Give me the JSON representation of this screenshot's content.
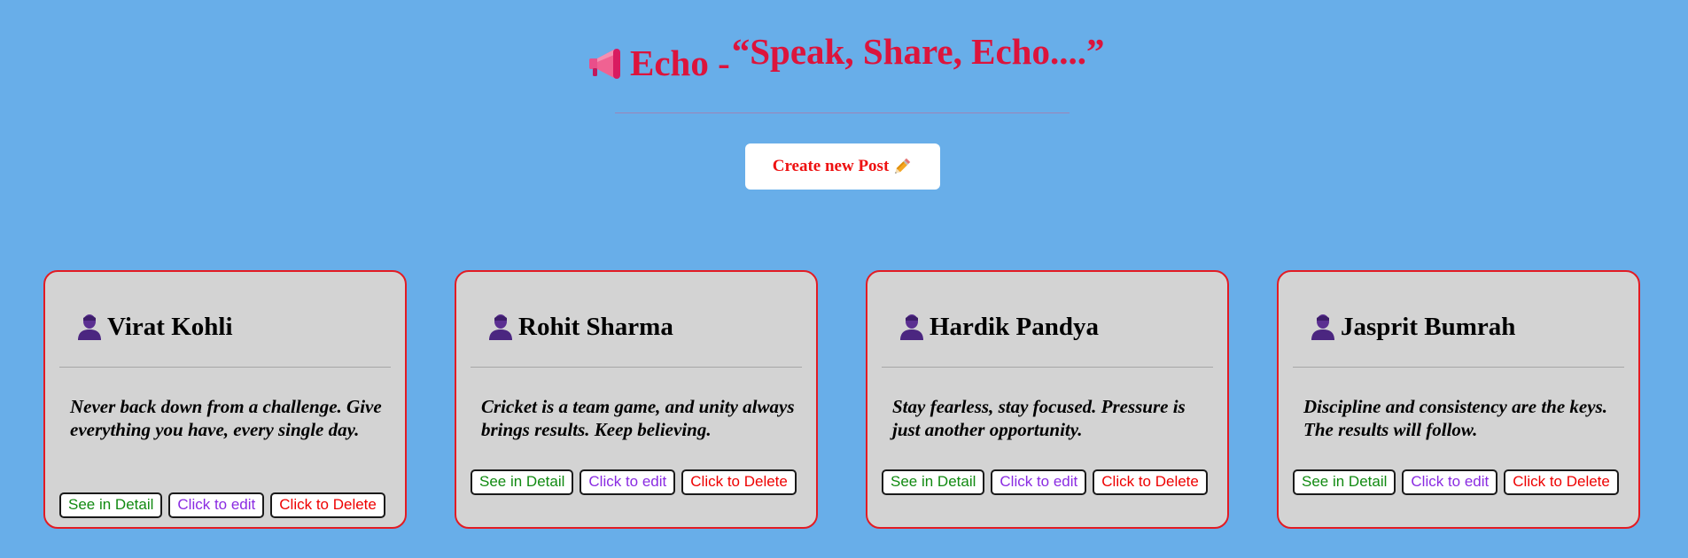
{
  "header": {
    "title": "Echo -",
    "tagline": "“Speak, Share, Echo....”",
    "megaphone_icon": "megaphone-icon",
    "create_button": "Create new Post",
    "pencil_icon": "pencil-icon"
  },
  "colors": {
    "background": "#68aee9",
    "title": "#dc143c",
    "card_background": "#d3d3d3",
    "card_border": "#e31b23",
    "detail": "#118a11",
    "edit": "#8a2be2",
    "delete": "#ee0000"
  },
  "posts": [
    {
      "author": "Virat Kohli",
      "icon": "user-icon",
      "content": "Never back down from a challenge. Give everything you have, every single day.",
      "detail_label": "See in Detail",
      "edit_label": "Click to edit",
      "delete_label": "Click to Delete"
    },
    {
      "author": "Rohit Sharma",
      "icon": "user-icon",
      "content": "Cricket is a team game, and unity always brings results. Keep believing.",
      "detail_label": "See in Detail",
      "edit_label": "Click to edit",
      "delete_label": "Click to Delete"
    },
    {
      "author": "Hardik Pandya",
      "icon": "user-icon",
      "content": "Stay fearless, stay focused. Pressure is just another opportunity.",
      "detail_label": "See in Detail",
      "edit_label": "Click to edit",
      "delete_label": "Click to Delete"
    },
    {
      "author": "Jasprit Bumrah",
      "icon": "user-icon",
      "content": "Discipline and consistency are the keys. The results will follow.",
      "detail_label": "See in Detail",
      "edit_label": "Click to edit",
      "delete_label": "Click to Delete"
    }
  ]
}
